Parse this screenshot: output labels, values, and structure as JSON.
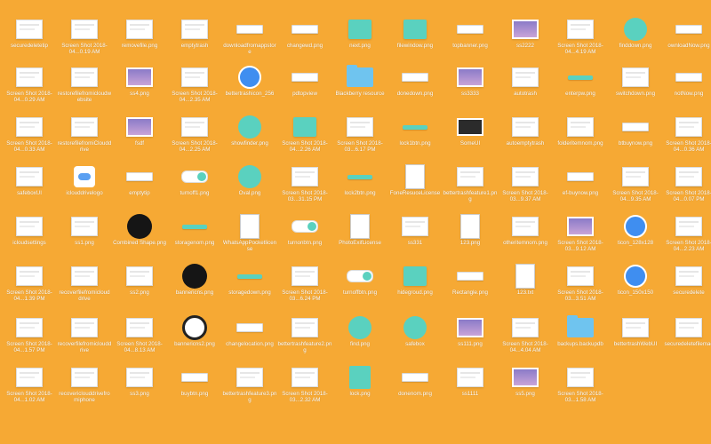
{
  "desktop": {
    "background": "#f6a934",
    "items": [
      {
        "label": "securedeletetip",
        "icon": "screenshot-thumb-icon"
      },
      {
        "label": "Screen Shot 2018-04...0.19 AM",
        "icon": "screenshot-thumb-icon"
      },
      {
        "label": "removefile.png",
        "icon": "screenshot-thumb-icon"
      },
      {
        "label": "emptytrash",
        "icon": "screenshot-thumb-icon"
      },
      {
        "label": "downloadfromappstore",
        "icon": "pill-button-icon"
      },
      {
        "label": "changewd.png",
        "icon": "pill-button-icon"
      },
      {
        "label": "next.png",
        "icon": "teal-button-icon"
      },
      {
        "label": "filewindow.png",
        "icon": "teal-button-icon"
      },
      {
        "label": "topbanner.png",
        "icon": "pill-button-icon"
      },
      {
        "label": "ss2222",
        "icon": "purple-image-icon"
      },
      {
        "label": "Screen Shot 2018-04...4.19 AM",
        "icon": "screenshot-thumb-icon"
      },
      {
        "label": "finddown.png",
        "icon": "teal-circle-icon"
      },
      {
        "label": "ownloadNow.png",
        "icon": "pill-button-icon"
      },
      {
        "label": "Screen Shot 2018-04...0.29 AM",
        "icon": "screenshot-thumb-icon"
      },
      {
        "label": "restorefilefromicloudwebsite",
        "icon": "screenshot-thumb-icon"
      },
      {
        "label": "ss4.png",
        "icon": "purple-image-icon"
      },
      {
        "label": "Screen Shot 2018-04...2.35 AM",
        "icon": "screenshot-thumb-icon"
      },
      {
        "label": "bettertrashicon_256",
        "icon": "blue-circle-icon"
      },
      {
        "label": "pdtopview",
        "icon": "pill-button-icon"
      },
      {
        "label": "Blackberry resource",
        "icon": "folder-icon"
      },
      {
        "label": "donedown.png",
        "icon": "pill-button-icon"
      },
      {
        "label": "ss3333",
        "icon": "purple-image-icon"
      },
      {
        "label": "autotrash",
        "icon": "screenshot-thumb-icon"
      },
      {
        "label": "enterpw.png",
        "icon": "teal-line-icon"
      },
      {
        "label": "switchdown.png",
        "icon": "screenshot-thumb-icon"
      },
      {
        "label": "notNow.png",
        "icon": "pill-button-icon"
      },
      {
        "label": "Screen Shot 2018-04...0.33 AM",
        "icon": "screenshot-thumb-icon"
      },
      {
        "label": "restorefilefromiClouddrive",
        "icon": "screenshot-thumb-icon"
      },
      {
        "label": "fsdf",
        "icon": "purple-image-icon"
      },
      {
        "label": "Screen Shot 2018-04...2.25 AM",
        "icon": "screenshot-thumb-icon"
      },
      {
        "label": "showfinder.png",
        "icon": "teal-circle-icon"
      },
      {
        "label": "Screen Shot 2018-04...2.26 AM",
        "icon": "teal-button-icon"
      },
      {
        "label": "Screen Shot 2018-03...6.17 PM",
        "icon": "screenshot-thumb-icon"
      },
      {
        "label": "lock1btn.png",
        "icon": "teal-line-icon"
      },
      {
        "label": "SomeUI",
        "icon": "dark-image-icon"
      },
      {
        "label": "autoemptytrash",
        "icon": "screenshot-thumb-icon"
      },
      {
        "label": "folderitemnom.png",
        "icon": "screenshot-thumb-icon"
      },
      {
        "label": "btbuynow.png",
        "icon": "pill-button-icon"
      },
      {
        "label": "Screen Shot 2018-04...0.36 AM",
        "icon": "screenshot-thumb-icon"
      },
      {
        "label": "safeboxUI",
        "icon": "screenshot-thumb-icon"
      },
      {
        "label": "iclouddrivelogo",
        "icon": "cloud-icon"
      },
      {
        "label": "emptytip",
        "icon": "pill-button-icon"
      },
      {
        "label": "turnoff1.png",
        "icon": "toggle-icon"
      },
      {
        "label": "Oval.png",
        "icon": "teal-circle-icon"
      },
      {
        "label": "Screen Shot 2018-03...31.15 PM",
        "icon": "screenshot-thumb-icon"
      },
      {
        "label": "lock2btn.png",
        "icon": "teal-line-icon"
      },
      {
        "label": "FoneResuceLicense",
        "icon": "document-icon"
      },
      {
        "label": "bettertrashfeature1.png",
        "icon": "screenshot-thumb-icon"
      },
      {
        "label": "Screen Shot 2018-03...9.37 AM",
        "icon": "screenshot-thumb-icon"
      },
      {
        "label": "ef-buynow.png",
        "icon": "pill-button-icon"
      },
      {
        "label": "Screen Shot 2018-04...9.35 AM",
        "icon": "screenshot-thumb-icon"
      },
      {
        "label": "Screen Shot 2018-04...0.07 PM",
        "icon": "screenshot-thumb-icon"
      },
      {
        "label": "icloudsettings",
        "icon": "screenshot-thumb-icon"
      },
      {
        "label": "ss1.png",
        "icon": "screenshot-thumb-icon"
      },
      {
        "label": "Combined Shape.png",
        "icon": "black-blob-icon"
      },
      {
        "label": "storagenom.png",
        "icon": "teal-line-icon"
      },
      {
        "label": "WhatsAppPocketlicense",
        "icon": "document-icon"
      },
      {
        "label": "turnonbtn.png",
        "icon": "toggle-icon"
      },
      {
        "label": "PhotoExifLicense",
        "icon": "document-icon"
      },
      {
        "label": "ss331",
        "icon": "screenshot-thumb-icon"
      },
      {
        "label": "123.png",
        "icon": "document-icon"
      },
      {
        "label": "otheritemnom.png",
        "icon": "screenshot-thumb-icon"
      },
      {
        "label": "Screen Shot 2018-03...9.12 AM",
        "icon": "purple-image-icon"
      },
      {
        "label": "ticon_128x128",
        "icon": "blue-circle-icon"
      },
      {
        "label": "Screen Shot 2018-04...2.23 AM",
        "icon": "screenshot-thumb-icon"
      },
      {
        "label": "Screen Shot 2018-04...1.39 PM",
        "icon": "screenshot-thumb-icon"
      },
      {
        "label": "recoverfilefromicloud drive",
        "icon": "screenshot-thumb-icon"
      },
      {
        "label": "ss2.png",
        "icon": "screenshot-thumb-icon"
      },
      {
        "label": "bannericns.png",
        "icon": "black-blob-icon"
      },
      {
        "label": "storagedown.png",
        "icon": "teal-line-icon"
      },
      {
        "label": "Screen Shot 2018-03...6.24 PM",
        "icon": "screenshot-thumb-icon"
      },
      {
        "label": "turnoffbtn.png",
        "icon": "toggle-icon"
      },
      {
        "label": "hidegroud.png",
        "icon": "teal-button-icon"
      },
      {
        "label": "Rectangle.png",
        "icon": "pill-button-icon"
      },
      {
        "label": "123.txt",
        "icon": "document-icon"
      },
      {
        "label": "Screen Shot 2018-03...3.51 AM",
        "icon": "screenshot-thumb-icon"
      },
      {
        "label": "ticon_150x150",
        "icon": "blue-circle-icon"
      },
      {
        "label": "securedelete",
        "icon": "screenshot-thumb-icon"
      },
      {
        "label": "Screen Shot 2018-04...1.57 PM",
        "icon": "screenshot-thumb-icon"
      },
      {
        "label": "recoverfilefromiclouddrive",
        "icon": "screenshot-thumb-icon"
      },
      {
        "label": "Screen Shot 2018-04...8.13 AM",
        "icon": "screenshot-thumb-icon"
      },
      {
        "label": "bannericns2.png",
        "icon": "gear-icon"
      },
      {
        "label": "changelocation.png",
        "icon": "pill-button-icon"
      },
      {
        "label": "bettertrashfeature2.png",
        "icon": "screenshot-thumb-icon"
      },
      {
        "label": "find.png",
        "icon": "teal-circle-icon"
      },
      {
        "label": "safebox",
        "icon": "teal-circle-icon"
      },
      {
        "label": "ss111.png",
        "icon": "purple-image-icon"
      },
      {
        "label": "Screen Shot 2018-04...4.04 AM",
        "icon": "screenshot-thumb-icon"
      },
      {
        "label": "backups.backupdb",
        "icon": "folder-icon"
      },
      {
        "label": "bettertrashWebUI",
        "icon": "screenshot-thumb-icon"
      },
      {
        "label": "securedeletefilemac",
        "icon": "screenshot-thumb-icon"
      },
      {
        "label": "Screen Shot 2018-04...1.02 AM",
        "icon": "screenshot-thumb-icon"
      },
      {
        "label": "recovericlouddrivefromiphone",
        "icon": "screenshot-thumb-icon"
      },
      {
        "label": "ss3.png",
        "icon": "screenshot-thumb-icon"
      },
      {
        "label": "buybtn.png",
        "icon": "pill-button-icon"
      },
      {
        "label": "bettertrashfeature3.png",
        "icon": "screenshot-thumb-icon"
      },
      {
        "label": "Screen Shot 2018-03...2.32 AM",
        "icon": "screenshot-thumb-icon"
      },
      {
        "label": "lock.png",
        "icon": "lock-icon"
      },
      {
        "label": "donenom.png",
        "icon": "pill-button-icon"
      },
      {
        "label": "ss1111",
        "icon": "screenshot-thumb-icon"
      },
      {
        "label": "ss5.png",
        "icon": "purple-image-icon"
      },
      {
        "label": "Screen Shot 2018-03...1.58 AM",
        "icon": "screenshot-thumb-icon"
      }
    ]
  }
}
